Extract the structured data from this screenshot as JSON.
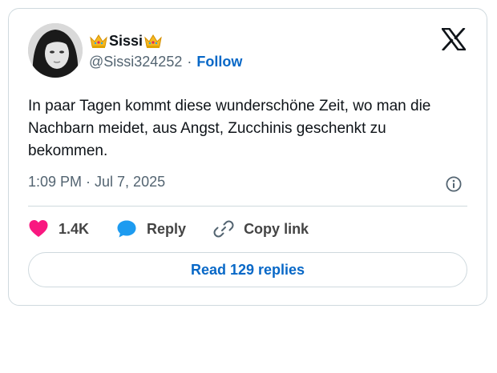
{
  "author": {
    "display_name": "Sissi",
    "handle": "@Sissi324252",
    "separator": "·",
    "follow_label": "Follow"
  },
  "icons": {
    "crown": "crown-icon",
    "logo": "x-logo-icon",
    "info": "info-icon",
    "like": "heart-icon",
    "reply": "speech-bubble-icon",
    "copy": "link-icon"
  },
  "tweet": {
    "text": "In paar Tagen kommt diese wunderschöne Zeit, wo man die Nachbarn meidet, aus Angst, Zucchinis geschenkt zu bekommen.",
    "timestamp": "1:09 PM · Jul 7, 2025"
  },
  "actions": {
    "likes": "1.4K",
    "reply_label": "Reply",
    "copy_label": "Copy link"
  },
  "read_replies_label": "Read 129 replies",
  "colors": {
    "link_blue": "#0868c7",
    "heart_pink": "#f91880",
    "reply_blue": "#1d9bf0",
    "muted": "#536471",
    "border": "#cfd9de"
  }
}
